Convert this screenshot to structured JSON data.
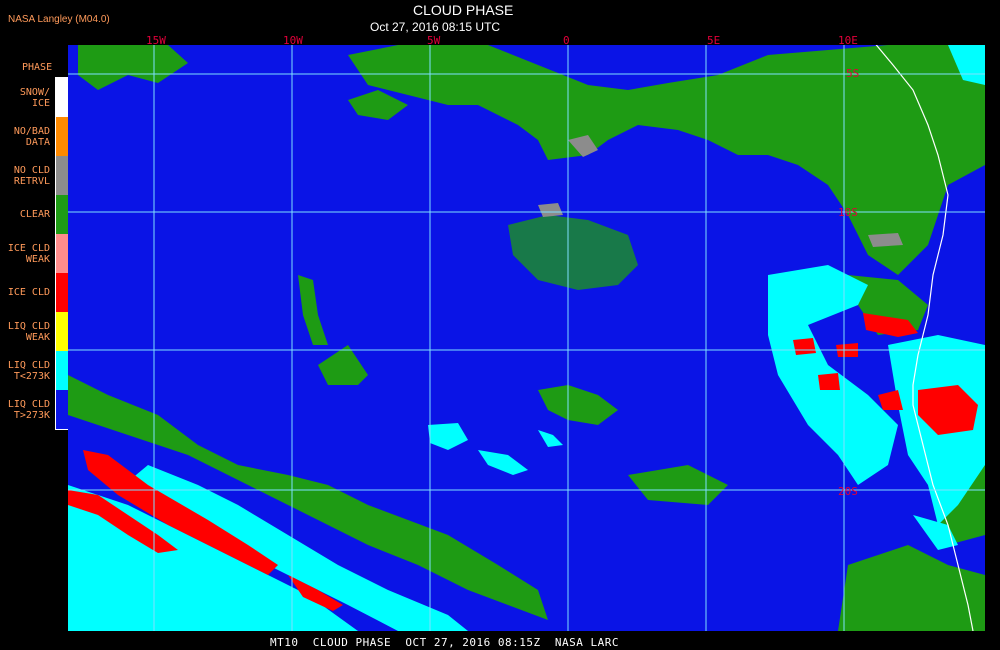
{
  "header": {
    "title": "CLOUD PHASE",
    "timestamp": "Oct 27, 2016 08:15 UTC",
    "source": "NASA Langley (M04.0)"
  },
  "footer": {
    "caption": "MT10  CLOUD PHASE  OCT 27, 2016 08:15Z  NASA LARC"
  },
  "legend": {
    "title": "PHASE",
    "items": [
      {
        "line1": "SNOW/",
        "line2": "ICE",
        "color": "#ffffff"
      },
      {
        "line1": "NO/BAD",
        "line2": "DATA",
        "color": "#ff8a00"
      },
      {
        "line1": "NO CLD",
        "line2": "RETRVL",
        "color": "#8c8c8c"
      },
      {
        "line1": "CLEAR",
        "line2": "",
        "color": "#1e9b14"
      },
      {
        "line1": "ICE CLD",
        "line2": "WEAK",
        "color": "#ff8c8c"
      },
      {
        "line1": "ICE CLD",
        "line2": "",
        "color": "#ff0000"
      },
      {
        "line1": "LIQ CLD",
        "line2": "WEAK",
        "color": "#ffff00"
      },
      {
        "line1": "LIQ CLD",
        "line2": "T<273K",
        "color": "#00ffff"
      },
      {
        "line1": "LIQ CLD",
        "line2": "T>273K",
        "color": "#0a14e6"
      }
    ]
  },
  "map": {
    "lon_labels": [
      "15W",
      "10W",
      "5W",
      "0",
      "5E",
      "10E"
    ],
    "lat_labels": [
      "5S",
      "10S",
      "20S"
    ],
    "grid_color": "#7fe0ff",
    "coast_color": "#ffffff"
  }
}
